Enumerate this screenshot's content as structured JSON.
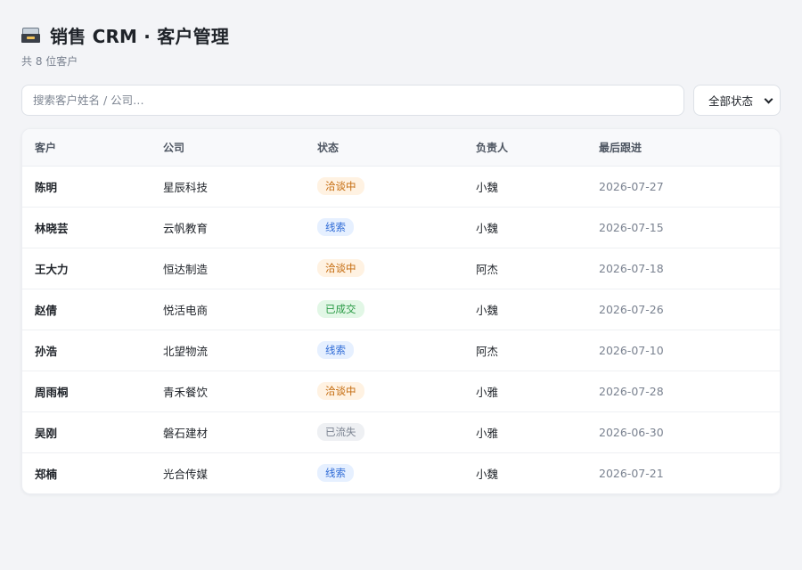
{
  "header": {
    "title": "销售 CRM · 客户管理",
    "subtitle": "共 8 位客户",
    "icon": "card-file-box-icon"
  },
  "toolbar": {
    "search_placeholder": "搜索客户姓名 / 公司…",
    "search_value": "",
    "status_filter_value": "全部状态"
  },
  "table": {
    "columns": [
      "客户",
      "公司",
      "状态",
      "负责人",
      "最后跟进"
    ],
    "rows": [
      {
        "name": "陈明",
        "company": "星辰科技",
        "status": "洽谈中",
        "status_kind": "talking",
        "owner": "小魏",
        "last_follow": "2026-07-27"
      },
      {
        "name": "林晓芸",
        "company": "云帆教育",
        "status": "线索",
        "status_kind": "lead",
        "owner": "小魏",
        "last_follow": "2026-07-15"
      },
      {
        "name": "王大力",
        "company": "恒达制造",
        "status": "洽谈中",
        "status_kind": "talking",
        "owner": "阿杰",
        "last_follow": "2026-07-18"
      },
      {
        "name": "赵倩",
        "company": "悦活电商",
        "status": "已成交",
        "status_kind": "won",
        "owner": "小魏",
        "last_follow": "2026-07-26"
      },
      {
        "name": "孙浩",
        "company": "北望物流",
        "status": "线索",
        "status_kind": "lead",
        "owner": "阿杰",
        "last_follow": "2026-07-10"
      },
      {
        "name": "周雨桐",
        "company": "青禾餐饮",
        "status": "洽谈中",
        "status_kind": "talking",
        "owner": "小雅",
        "last_follow": "2026-07-28"
      },
      {
        "name": "吴刚",
        "company": "磐石建材",
        "status": "已流失",
        "status_kind": "lost",
        "owner": "小雅",
        "last_follow": "2026-06-30"
      },
      {
        "name": "郑楠",
        "company": "光合传媒",
        "status": "线索",
        "status_kind": "lead",
        "owner": "小魏",
        "last_follow": "2026-07-21"
      }
    ]
  },
  "colors": {
    "talking": "#c46a0c",
    "lead": "#2f6bd6",
    "won": "#2a9a45",
    "lost": "#7a8290"
  }
}
